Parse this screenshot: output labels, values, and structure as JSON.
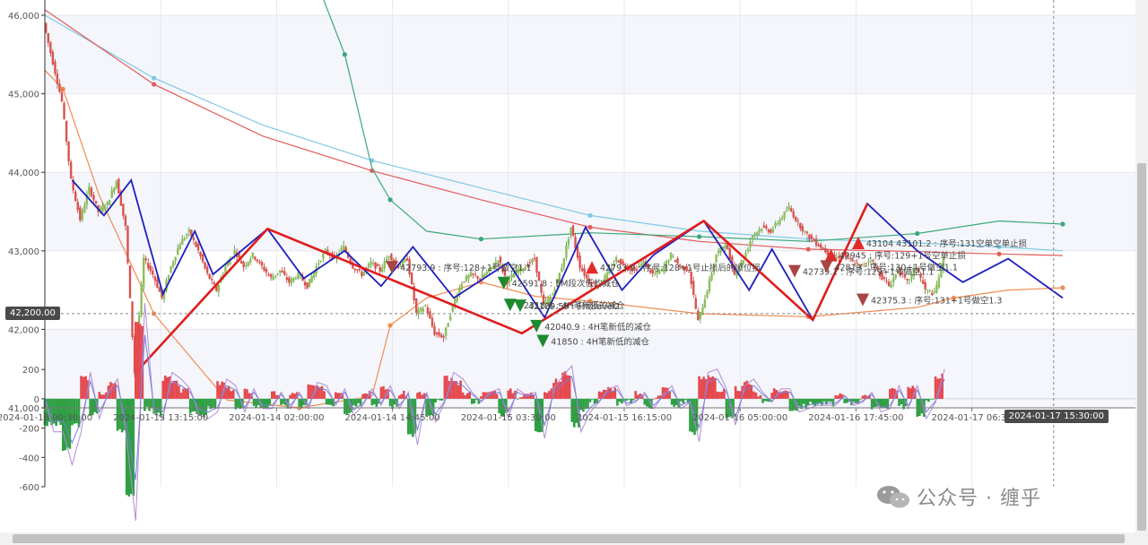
{
  "chart_data": [
    {
      "type": "candlestick",
      "title": "",
      "ylim": [
        41000,
        46000
      ],
      "y_ticks": [
        {
          "v": 46000,
          "label": "46,000"
        },
        {
          "v": 45000,
          "label": "45,000"
        },
        {
          "v": 44000,
          "label": "44,000"
        },
        {
          "v": 43000,
          "label": "43,000"
        },
        {
          "v": 42000,
          "label": "42,000"
        },
        {
          "v": 41000,
          "label": "41,000"
        }
      ],
      "x_ticks": [
        {
          "t": 0,
          "label": "2024-01-13 00:30:00"
        },
        {
          "t": 12.75,
          "label": "2024-01-13 13:15:00"
        },
        {
          "t": 25.5,
          "label": "2024-01-14 02:00:00"
        },
        {
          "t": 38.25,
          "label": "2024-01-14 14:45:00"
        },
        {
          "t": 51,
          "label": "2024-01-15 03:30:00"
        },
        {
          "t": 63.75,
          "label": "2024-01-15 16:15:00"
        },
        {
          "t": 76.5,
          "label": "2024-01-16 05:00:00"
        },
        {
          "t": 89.25,
          "label": "2024-01-16 17:45:00"
        },
        {
          "t": 102,
          "label": "2024-01-17 06:30"
        }
      ],
      "x_unit": "hours since 2024-01-13 00:30",
      "x_range": [
        0,
        120
      ],
      "cursor": {
        "t": 111,
        "price": 42200,
        "time_label": "2024-01-17 15:30:00",
        "price_label": "42,200.00"
      },
      "price_path": [
        [
          0,
          45900
        ],
        [
          1,
          45400
        ],
        [
          2,
          44900
        ],
        [
          3,
          43900
        ],
        [
          4,
          43400
        ],
        [
          5,
          43800
        ],
        [
          6,
          43500
        ],
        [
          7,
          43600
        ],
        [
          8,
          43900
        ],
        [
          9,
          43300
        ],
        [
          10,
          41450
        ],
        [
          11,
          42900
        ],
        [
          12,
          42700
        ],
        [
          13,
          42400
        ],
        [
          14,
          42800
        ],
        [
          15,
          43100
        ],
        [
          16,
          43250
        ],
        [
          17,
          43000
        ],
        [
          18,
          42700
        ],
        [
          19,
          42500
        ],
        [
          20,
          42800
        ],
        [
          21,
          43000
        ],
        [
          22,
          42800
        ],
        [
          23,
          42950
        ],
        [
          24,
          42800
        ],
        [
          25,
          42650
        ],
        [
          26,
          42750
        ],
        [
          27,
          42600
        ],
        [
          28,
          42700
        ],
        [
          29,
          42550
        ],
        [
          30,
          42800
        ],
        [
          31,
          43000
        ],
        [
          32,
          42900
        ],
        [
          33,
          43050
        ],
        [
          34,
          42800
        ],
        [
          35,
          42700
        ],
        [
          36,
          42850
        ],
        [
          37,
          42750
        ],
        [
          38,
          42950
        ],
        [
          39,
          42800
        ],
        [
          40,
          42900
        ],
        [
          41,
          42200
        ],
        [
          42,
          42300
        ],
        [
          43,
          41950
        ],
        [
          44,
          41900
        ],
        [
          45,
          42300
        ],
        [
          46,
          42600
        ],
        [
          47,
          42700
        ],
        [
          48,
          42650
        ],
        [
          49,
          42750
        ],
        [
          50,
          42900
        ],
        [
          51,
          42600
        ],
        [
          52,
          42750
        ],
        [
          53,
          42800
        ],
        [
          54,
          42900
        ],
        [
          55,
          42300
        ],
        [
          56,
          42450
        ],
        [
          57,
          42800
        ],
        [
          58,
          43300
        ],
        [
          59,
          42800
        ],
        [
          60,
          42600
        ],
        [
          61,
          42550
        ],
        [
          62,
          42700
        ],
        [
          63,
          42900
        ],
        [
          64,
          42800
        ],
        [
          65,
          42750
        ],
        [
          66,
          42850
        ],
        [
          67,
          42700
        ],
        [
          68,
          42750
        ],
        [
          69,
          42950
        ],
        [
          70,
          42800
        ],
        [
          71,
          42750
        ],
        [
          72,
          42100
        ],
        [
          73,
          42500
        ],
        [
          74,
          42950
        ],
        [
          75,
          43100
        ],
        [
          76,
          42700
        ],
        [
          77,
          42900
        ],
        [
          78,
          43200
        ],
        [
          79,
          43300
        ],
        [
          80,
          43250
        ],
        [
          81,
          43400
        ],
        [
          82,
          43550
        ],
        [
          83,
          43350
        ],
        [
          84,
          43200
        ],
        [
          85,
          43100
        ],
        [
          86,
          43000
        ],
        [
          87,
          42900
        ],
        [
          88,
          42950
        ],
        [
          89,
          42850
        ],
        [
          90,
          42800
        ],
        [
          91,
          42900
        ],
        [
          92,
          42700
        ],
        [
          93,
          42550
        ],
        [
          94,
          42750
        ],
        [
          95,
          42600
        ],
        [
          96,
          42800
        ],
        [
          97,
          42500
        ],
        [
          98,
          42450
        ],
        [
          99,
          42900
        ]
      ],
      "series": [
        {
          "name": "",
          "color": "#7fc9e6",
          "points": [
            [
              0,
              46000
            ],
            [
              12,
              45200
            ],
            [
              24,
              44600
            ],
            [
              36,
              44150
            ],
            [
              48,
              43800
            ],
            [
              60,
              43450
            ],
            [
              72,
              43250
            ],
            [
              84,
              43150
            ],
            [
              96,
              43100
            ],
            [
              105,
              43050
            ],
            [
              112,
              43000
            ]
          ]
        },
        {
          "name": "",
          "color": "#e45a5a",
          "points": [
            [
              0,
              46070
            ],
            [
              12,
              45120
            ],
            [
              24,
              44460
            ],
            [
              36,
              44020
            ],
            [
              48,
              43650
            ],
            [
              60,
              43300
            ],
            [
              72,
              43120
            ],
            [
              84,
              43020
            ],
            [
              96,
              42990
            ],
            [
              105,
              42960
            ],
            [
              112,
              42940
            ]
          ]
        },
        {
          "name": "",
          "color": "#f08c54",
          "points": [
            [
              0,
              45300
            ],
            [
              2,
              45060
            ],
            [
              6,
              43700
            ],
            [
              12,
              42200
            ],
            [
              20,
              41100
            ],
            [
              28,
              41000
            ],
            [
              36,
              41150
            ],
            [
              38,
              42050
            ],
            [
              42,
              42400
            ],
            [
              48,
              42600
            ],
            [
              54,
              42420
            ],
            [
              60,
              42360
            ],
            [
              72,
              42200
            ],
            [
              84,
              42160
            ],
            [
              96,
              42280
            ],
            [
              100,
              42400
            ],
            [
              106,
              42500
            ],
            [
              112,
              42530
            ]
          ]
        },
        {
          "name": "",
          "color": "#3aa87a",
          "points": [
            [
              28,
              47000
            ],
            [
              33,
              45500
            ],
            [
              36,
              44050
            ],
            [
              38,
              43650
            ],
            [
              42,
              43250
            ],
            [
              48,
              43150
            ],
            [
              60,
              43230
            ],
            [
              72,
              43180
            ],
            [
              84,
              43120
            ],
            [
              96,
              43220
            ],
            [
              105,
              43380
            ],
            [
              112,
              43340
            ]
          ]
        }
      ],
      "zigzag_red": [
        [
          10,
          41450
        ],
        [
          24.5,
          43280
        ],
        [
          52.5,
          41950
        ],
        [
          72.5,
          43380
        ],
        [
          84.5,
          42120
        ],
        [
          90.5,
          43600
        ]
      ],
      "zigzag_blue": [
        [
          3,
          43900
        ],
        [
          6.5,
          43450
        ],
        [
          9.5,
          43900
        ],
        [
          13,
          42450
        ],
        [
          16.5,
          43250
        ],
        [
          18.5,
          42700
        ],
        [
          24.5,
          43280
        ],
        [
          28.5,
          42650
        ],
        [
          33,
          43000
        ],
        [
          37,
          42550
        ],
        [
          40.5,
          43050
        ],
        [
          45,
          42400
        ],
        [
          51,
          42850
        ],
        [
          55,
          42150
        ],
        [
          59.5,
          43300
        ],
        [
          63.5,
          42500
        ],
        [
          67,
          42950
        ],
        [
          72.5,
          43380
        ],
        [
          77.5,
          42500
        ],
        [
          80,
          43020
        ],
        [
          84.5,
          42120
        ],
        [
          90.5,
          43600
        ],
        [
          96,
          43000
        ],
        [
          101,
          42600
        ],
        [
          106,
          42900
        ],
        [
          112,
          42400
        ]
      ],
      "markers": [
        {
          "t": 38.2,
          "price": 42790,
          "type": "sell",
          "label": "42793.9 : 序号:128+1号做空1.1"
        },
        {
          "t": 50.5,
          "price": 42590,
          "type": "buy",
          "label": "42591.8 : 5M段次低的减仓"
        },
        {
          "t": 51.2,
          "price": 42310,
          "type": "buy",
          "label": "42318.8 : 4H笔新低的减仓"
        },
        {
          "t": 52.3,
          "price": 42300,
          "type": "buy",
          "label": "42189.59 : 升级level2"
        },
        {
          "t": 54.1,
          "price": 42040,
          "type": "buy",
          "label": "42040.9 : 4H笔新低的减仓"
        },
        {
          "t": 54.8,
          "price": 41850,
          "type": "buy",
          "label": "41850 : 4H笔新低的减仓"
        },
        {
          "t": 60.2,
          "price": 42790,
          "type": "buy_red",
          "label": "42793.9 : 序号:128+1号止损后的顺位损"
        },
        {
          "t": 82.5,
          "price": 42740,
          "type": "sell",
          "label": "42739.1 : 序号:129+1号做空1.1"
        },
        {
          "t": 86.5,
          "price": 42945,
          "type": "buy_red",
          "label": "42945 : 序号:129+1号空单止损"
        },
        {
          "t": 89.5,
          "price": 43100,
          "type": "buy_red",
          "label": "43104 43101.2 : 序号:131空单空单止损"
        },
        {
          "t": 86,
          "price": 42800,
          "type": "sell",
          "label": "42819 : 序号:130+1号做空1.1"
        },
        {
          "t": 90,
          "price": 42375,
          "type": "sell",
          "label": "42375.3 : 序号:131+1号做空1.3"
        }
      ]
    },
    {
      "type": "bar",
      "title": "",
      "ylim": [
        -600,
        250
      ],
      "y_ticks": [
        {
          "v": 200,
          "label": "200"
        },
        {
          "v": 0,
          "label": "0"
        },
        {
          "v": -200,
          "label": "-200"
        },
        {
          "v": -400,
          "label": "-400"
        },
        {
          "v": -600,
          "label": "-600"
        }
      ]
    }
  ],
  "watermark": {
    "text": "公众号 · 缠乎",
    "icon": "wechat-icon"
  }
}
